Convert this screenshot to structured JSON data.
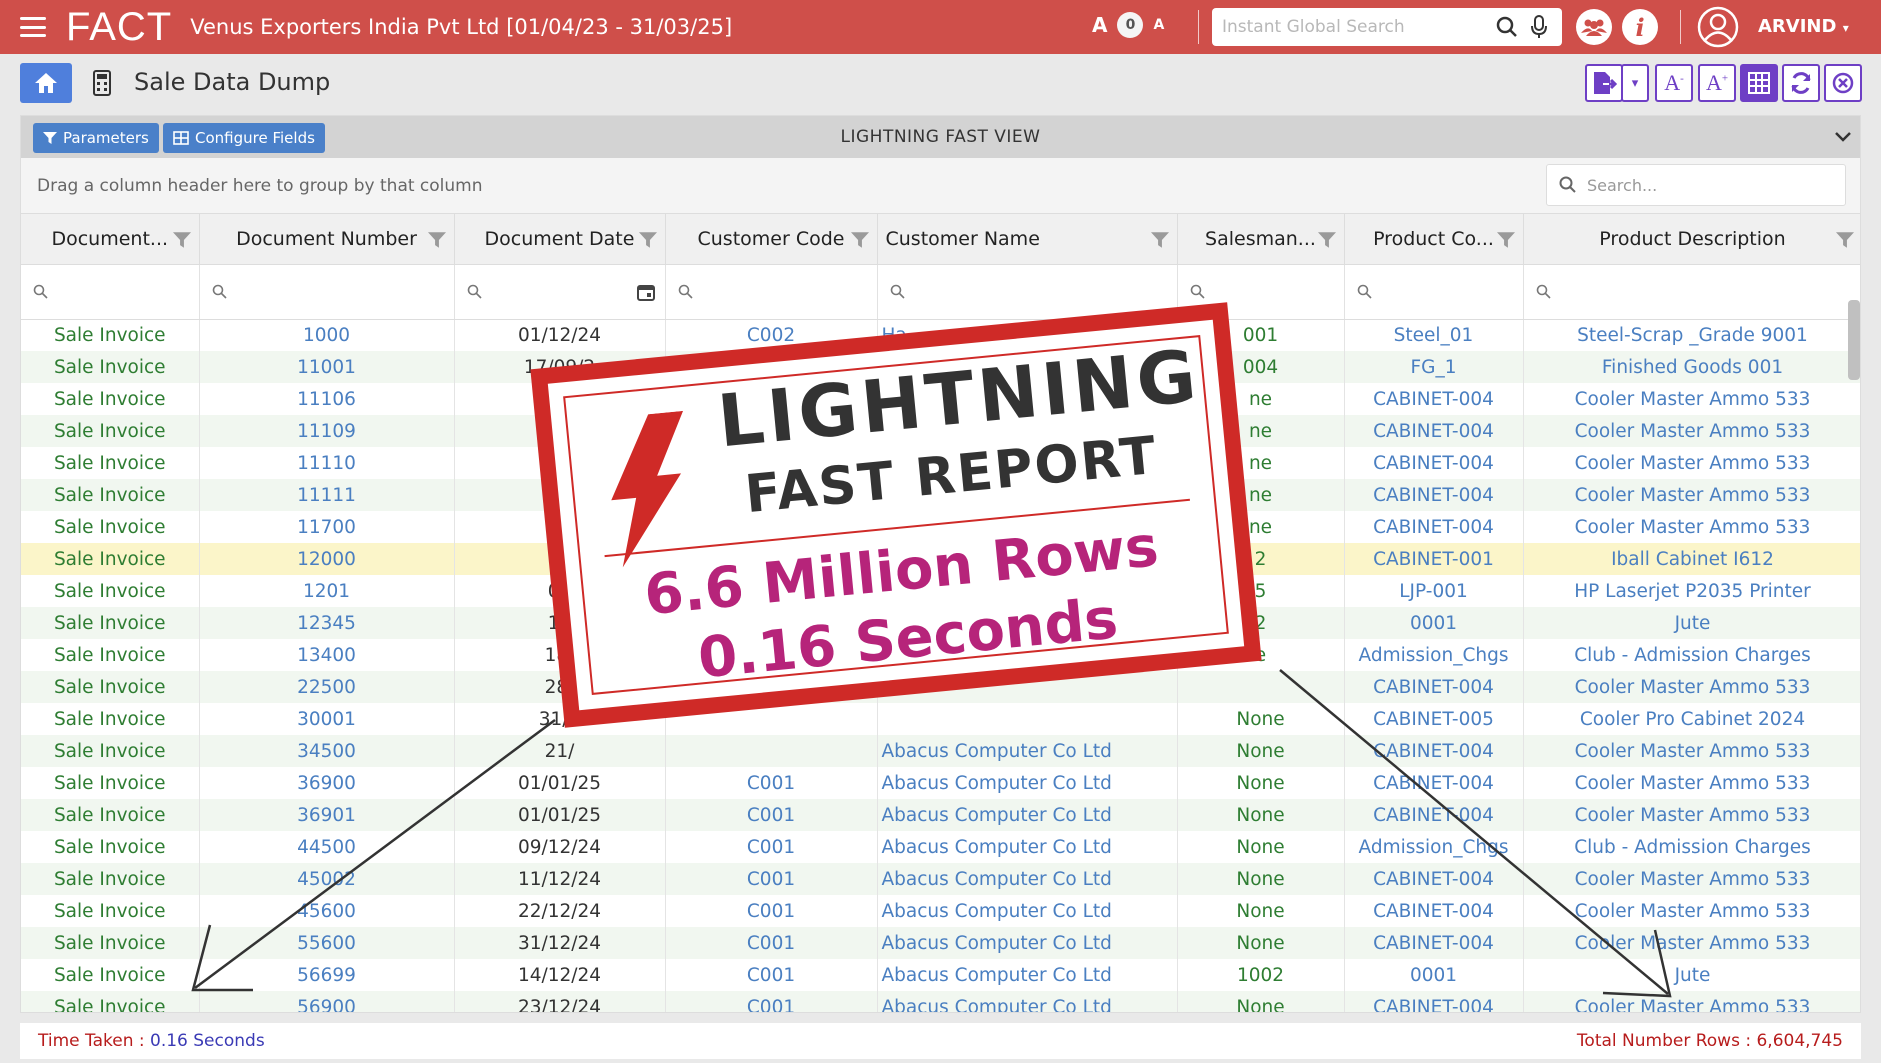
{
  "topbar": {
    "app_name": "FACT",
    "company": "Venus Exporters India Pvt Ltd [01/04/23 - 31/03/25]",
    "font_increase": "A",
    "font_level": "0",
    "font_decrease": "A",
    "search_placeholder": "Instant Global Search",
    "user": "ARVIND"
  },
  "page": {
    "title": "Sale Data Dump"
  },
  "panel": {
    "parameters_label": "Parameters",
    "configure_label": "Configure Fields",
    "view_title": "LIGHTNING FAST VIEW",
    "group_hint": "Drag a column header here to group by that column",
    "search_placeholder": "Search..."
  },
  "columns": [
    "Document...",
    "Document Number",
    "Document Date",
    "Customer Code",
    "Customer Name",
    "Salesman...",
    "Product Co...",
    "Product Description"
  ],
  "rows": [
    {
      "type": "Sale Invoice",
      "num": "1000",
      "date": "01/12/24",
      "code": "C002",
      "name": "Ha",
      "sales": "001",
      "pcode": "Steel_01",
      "desc": "Steel-Scrap _Grade 9001"
    },
    {
      "type": "Sale Invoice",
      "num": "11001",
      "date": "17/09/2",
      "code": "",
      "name": "",
      "sales": "004",
      "pcode": "FG_1",
      "desc": "Finished Goods 001"
    },
    {
      "type": "Sale Invoice",
      "num": "11106",
      "date": "2",
      "code": "",
      "name": "",
      "sales": "ne",
      "pcode": "CABINET-004",
      "desc": "Cooler Master Ammo 533"
    },
    {
      "type": "Sale Invoice",
      "num": "11109",
      "date": "2",
      "code": "",
      "name": "",
      "sales": "ne",
      "pcode": "CABINET-004",
      "desc": "Cooler Master Ammo 533"
    },
    {
      "type": "Sale Invoice",
      "num": "11110",
      "date": "2",
      "code": "",
      "name": "",
      "sales": "ne",
      "pcode": "CABINET-004",
      "desc": "Cooler Master Ammo 533"
    },
    {
      "type": "Sale Invoice",
      "num": "11111",
      "date": "2",
      "code": "",
      "name": "",
      "sales": "ne",
      "pcode": "CABINET-004",
      "desc": "Cooler Master Ammo 533"
    },
    {
      "type": "Sale Invoice",
      "num": "11700",
      "date": "3",
      "code": "",
      "name": "",
      "sales": "ne",
      "pcode": "CABINET-004",
      "desc": "Cooler Master Ammo 533"
    },
    {
      "type": "Sale Invoice",
      "num": "12000",
      "date": "14",
      "code": "",
      "name": "",
      "sales": "2",
      "pcode": "CABINET-001",
      "desc": "Iball Cabinet I612",
      "hl": true
    },
    {
      "type": "Sale Invoice",
      "num": "1201",
      "date": "01",
      "code": "",
      "name": "",
      "sales": "5",
      "pcode": "LJP-001",
      "desc": "HP Laserjet P2035 Printer"
    },
    {
      "type": "Sale Invoice",
      "num": "12345",
      "date": "14",
      "code": "",
      "name": "",
      "sales": "2",
      "pcode": "0001",
      "desc": "Jute"
    },
    {
      "type": "Sale Invoice",
      "num": "13400",
      "date": "18/",
      "code": "",
      "name": "",
      "sales": "e",
      "pcode": "Admission_Chgs",
      "desc": "Club - Admission Charges"
    },
    {
      "type": "Sale Invoice",
      "num": "22500",
      "date": "28/",
      "code": "",
      "name": "",
      "sales": "",
      "pcode": "CABINET-004",
      "desc": "Cooler Master Ammo 533"
    },
    {
      "type": "Sale Invoice",
      "num": "30001",
      "date": "31/0",
      "code": "",
      "name": "",
      "sales": "None",
      "pcode": "CABINET-005",
      "desc": "Cooler Pro Cabinet 2024"
    },
    {
      "type": "Sale Invoice",
      "num": "34500",
      "date": "21/",
      "code": "",
      "name": "Abacus Computer Co Ltd",
      "sales": "None",
      "pcode": "CABINET-004",
      "desc": "Cooler Master Ammo 533"
    },
    {
      "type": "Sale Invoice",
      "num": "36900",
      "date": "01/01/25",
      "code": "C001",
      "name": "Abacus Computer Co Ltd",
      "sales": "None",
      "pcode": "CABINET-004",
      "desc": "Cooler Master Ammo 533"
    },
    {
      "type": "Sale Invoice",
      "num": "36901",
      "date": "01/01/25",
      "code": "C001",
      "name": "Abacus Computer Co Ltd",
      "sales": "None",
      "pcode": "CABINET-004",
      "desc": "Cooler Master Ammo 533"
    },
    {
      "type": "Sale Invoice",
      "num": "44500",
      "date": "09/12/24",
      "code": "C001",
      "name": "Abacus Computer Co Ltd",
      "sales": "None",
      "pcode": "Admission_Chgs",
      "desc": "Club - Admission Charges"
    },
    {
      "type": "Sale Invoice",
      "num": "45002",
      "date": "11/12/24",
      "code": "C001",
      "name": "Abacus Computer Co Ltd",
      "sales": "None",
      "pcode": "CABINET-004",
      "desc": "Cooler Master Ammo 533"
    },
    {
      "type": "Sale Invoice",
      "num": "45600",
      "date": "22/12/24",
      "code": "C001",
      "name": "Abacus Computer Co Ltd",
      "sales": "None",
      "pcode": "CABINET-004",
      "desc": "Cooler Master Ammo 533"
    },
    {
      "type": "Sale Invoice",
      "num": "55600",
      "date": "31/12/24",
      "code": "C001",
      "name": "Abacus Computer Co Ltd",
      "sales": "None",
      "pcode": "CABINET-004",
      "desc": "Cooler Master Ammo 533"
    },
    {
      "type": "Sale Invoice",
      "num": "56699",
      "date": "14/12/24",
      "code": "C001",
      "name": "Abacus Computer Co Ltd",
      "sales": "1002",
      "pcode": "0001",
      "desc": "Jute"
    },
    {
      "type": "Sale Invoice",
      "num": "56900",
      "date": "23/12/24",
      "code": "C001",
      "name": "Abacus Computer Co Ltd",
      "sales": "None",
      "pcode": "CABINET-004",
      "desc": "Cooler Master Ammo 533"
    }
  ],
  "footer": {
    "time_label": "Time Taken : ",
    "time_value": "0.16 Seconds",
    "rows_label": "Total Number Rows : 6,604,745"
  },
  "stamp": {
    "line1": "LIGHTNING",
    "line2": "FAST REPORT",
    "line3": "6.6 Million Rows",
    "line4": "0.16 Seconds"
  },
  "colors": {
    "topbar": "#cf4f4a",
    "accent_blue": "#4a80c9",
    "toolbar_purple": "#6e3fc5",
    "stamp_red": "#cf2a27",
    "stamp_magenta": "#b6247a"
  }
}
